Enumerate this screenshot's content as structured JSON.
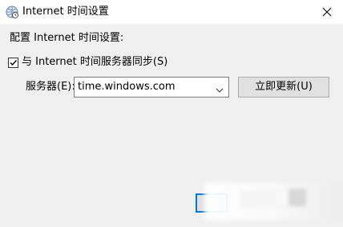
{
  "window": {
    "title": "Internet 时间设置",
    "close_icon": "close-icon",
    "app_icon": "internet-time-icon"
  },
  "config": {
    "section_label": "配置 Internet 时间设置:",
    "sync_checkbox": {
      "label": "与 Internet 时间服务器同步(S)",
      "checked": true
    },
    "server_label": "服务器(E):",
    "server_value": "time.windows.com",
    "update_button": "立即更新(U)"
  },
  "colors": {
    "accent": "#0078d7",
    "panel_bg": "#f0f0f0",
    "button_bg": "#e1e1e1"
  }
}
